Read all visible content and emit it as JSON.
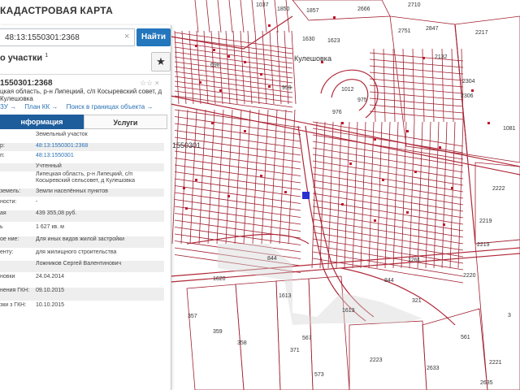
{
  "map": {
    "title": "КАДАСТРОВАЯ КАРТА",
    "locality": "Кулешовка",
    "quarter": "1550301",
    "parcel_labels": [
      {
        "text": "1037"
      },
      {
        "text": "1850"
      },
      {
        "text": "1857"
      },
      {
        "text": "2666"
      },
      {
        "text": "2710"
      },
      {
        "text": "2217"
      },
      {
        "text": "2751"
      },
      {
        "text": "2847"
      },
      {
        "text": "1630"
      },
      {
        "text": "1623"
      },
      {
        "text": "698"
      },
      {
        "text": "2132"
      },
      {
        "text": "2304"
      },
      {
        "text": "2306"
      },
      {
        "text": "1081"
      },
      {
        "text": "2222"
      },
      {
        "text": "2219"
      },
      {
        "text": "2219"
      },
      {
        "text": "2220"
      },
      {
        "text": "2221"
      },
      {
        "text": "844"
      },
      {
        "text": "844"
      },
      {
        "text": "1620"
      },
      {
        "text": "1613"
      },
      {
        "text": "1613"
      },
      {
        "text": "1261"
      },
      {
        "text": "357"
      },
      {
        "text": "359"
      },
      {
        "text": "358"
      },
      {
        "text": "371"
      },
      {
        "text": "567"
      },
      {
        "text": "573"
      },
      {
        "text": "561"
      },
      {
        "text": "2223"
      },
      {
        "text": "2633"
      },
      {
        "text": "2635"
      },
      {
        "text": "959"
      },
      {
        "text": "976"
      },
      {
        "text": "1012"
      },
      {
        "text": "975"
      },
      {
        "text": "321"
      },
      {
        "text": "3"
      }
    ]
  },
  "search": {
    "query": "48:13:1550301:2368",
    "clear_glyph": "×",
    "button_label": "Найти"
  },
  "section": {
    "title": "о участки",
    "count": "1",
    "star_glyph": "★"
  },
  "parcel": {
    "cad_number": "1550301:2368",
    "rating": "☆☆ ×",
    "address": "цкая область, р-н Липецкий, с/п Косыревский совет, д Кулешовка",
    "links": [
      "ЗУ →",
      "План КК →",
      "Поиск в границах объекта →"
    ]
  },
  "tabs": {
    "info": "нформация",
    "services": "Услуги"
  },
  "rows": [
    {
      "k": "",
      "v": "Земельный участок",
      "link": false
    },
    {
      "k": "р:",
      "v": "48:13:1550301:2368",
      "link": true
    },
    {
      "k": "п:",
      "v": "48:13:1550301",
      "link": true
    },
    {
      "k": "",
      "v": "Учтенный",
      "link": false
    },
    {
      "k": "",
      "v": "Липецкая область, р-н Липецкий, с/п Косыревский сельсовет, д Кулешовка",
      "link": false
    },
    {
      "k": "земель:",
      "v": "Земли населённых пунктов",
      "link": false
    },
    {
      "k": "ности:",
      "v": "-",
      "link": false
    },
    {
      "k": "ая",
      "v": "439 355,08 руб.",
      "link": false
    },
    {
      "k": "ь",
      "v": "1 627 кв. м",
      "link": false
    },
    {
      "k": "ое ние:",
      "v": "Для иных видов жилой застройки",
      "link": false
    },
    {
      "k": "енту:",
      "v": "для жилищного строительства",
      "link": false
    },
    {
      "k": "",
      "v": "Ложников Сергей Валентинович",
      "link": false
    },
    {
      "k": "новки",
      "v": "24.04.2014",
      "link": false
    },
    {
      "k": "нения ГКН:",
      "v": "09.10.2015",
      "link": false
    },
    {
      "k": "зки з ГКН:",
      "v": "10.10.2015",
      "link": false
    }
  ]
}
